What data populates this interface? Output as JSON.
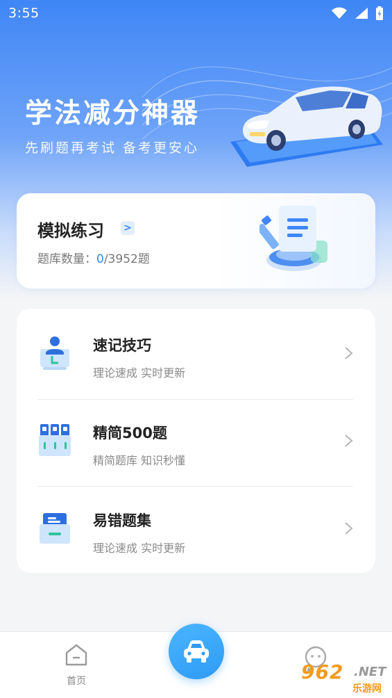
{
  "status": {
    "time": "3:55"
  },
  "hero": {
    "title": "学法减分神器",
    "subtitle": "先刷题再考试 备考更安心"
  },
  "practice": {
    "title": "模拟练习",
    "arrow": ">",
    "count_label": "题库数量：",
    "done": "0",
    "total": "/3952题"
  },
  "features": [
    {
      "title": "速记技巧",
      "desc": "理论速成 实时更新",
      "icon": "person-monitor-icon"
    },
    {
      "title": "精简500题",
      "desc": "精简题库 知识秒懂",
      "icon": "binders-icon"
    },
    {
      "title": "易错题集",
      "desc": "理论速成 实时更新",
      "icon": "archive-box-icon"
    }
  ],
  "tabbar": {
    "home_label": "首页"
  },
  "watermark": {
    "brand": "962",
    "net": ".NET",
    "sub": "乐游网"
  },
  "colors": {
    "accent": "#3f86f6",
    "tab_center": "#2f9bf5",
    "count_done": "#2d8cf0"
  }
}
